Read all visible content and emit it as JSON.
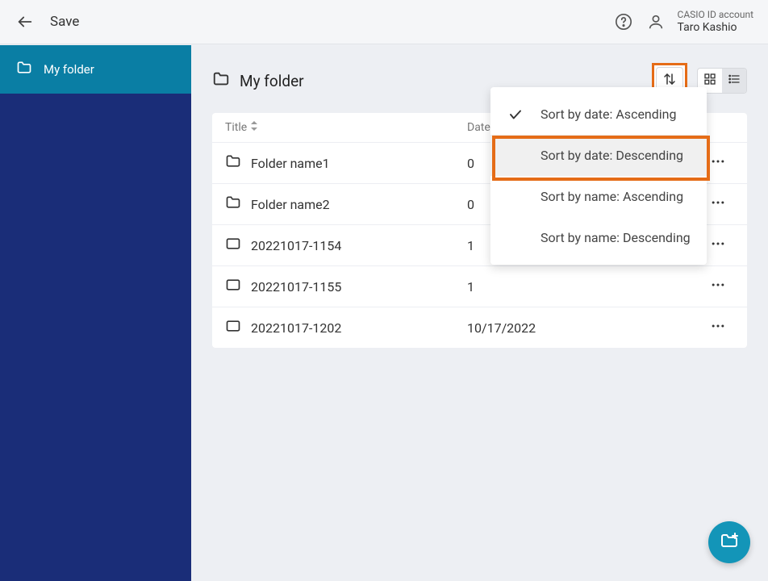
{
  "header": {
    "title": "Save",
    "account_label": "CASIO ID account",
    "account_name": "Taro Kashio"
  },
  "sidebar": {
    "items": [
      {
        "label": "My folder"
      }
    ]
  },
  "main": {
    "title": "My folder",
    "columns": {
      "title": "Title",
      "date": "Date"
    },
    "rows": [
      {
        "type": "folder",
        "name": "Folder name1",
        "date": "0"
      },
      {
        "type": "folder",
        "name": "Folder name2",
        "date": "0"
      },
      {
        "type": "file",
        "name": "20221017-1154",
        "date": "1"
      },
      {
        "type": "file",
        "name": "20221017-1155",
        "date": "1"
      },
      {
        "type": "file",
        "name": "20221017-1202",
        "date": "10/17/2022"
      }
    ]
  },
  "sort_menu": {
    "options": [
      {
        "label": "Sort by date: Ascending",
        "checked": true,
        "highlighted": false
      },
      {
        "label": "Sort by date: Descending",
        "checked": false,
        "highlighted": true
      },
      {
        "label": "Sort by name: Ascending",
        "checked": false,
        "highlighted": false
      },
      {
        "label": "Sort by name: Descending",
        "checked": false,
        "highlighted": false
      }
    ]
  }
}
